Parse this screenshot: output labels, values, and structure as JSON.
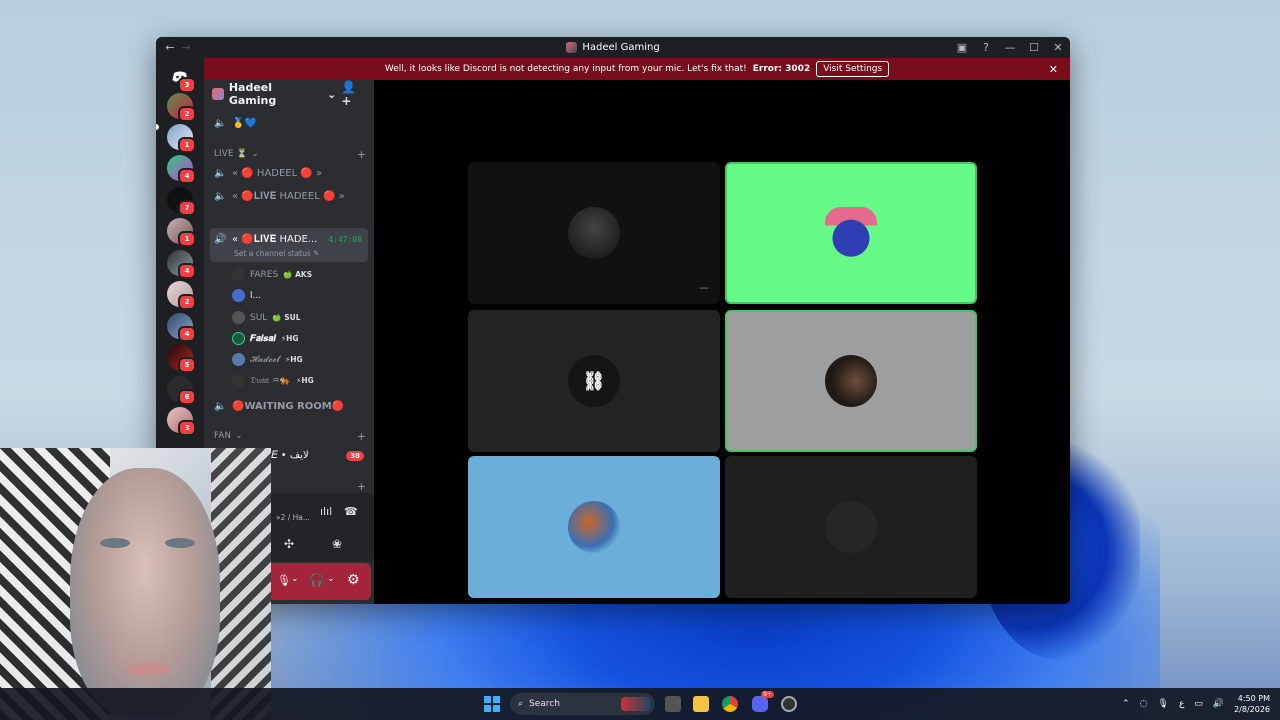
{
  "window": {
    "title": "Hadeel Gaming",
    "back_icon": "←",
    "forward_icon": "→"
  },
  "banner": {
    "message": "Well, it looks like Discord is not detecting any input from your mic. Let's fix that!",
    "error_label": "Error: 3002",
    "button_label": "Visit Settings",
    "close_icon": "✕"
  },
  "rail": {
    "badges": [
      "3",
      "2",
      "1",
      "4",
      "7",
      "1",
      "4",
      "2",
      "4",
      "5",
      "6",
      "3"
    ]
  },
  "server": {
    "name": "Hadeel Gaming",
    "chevron": "⌄",
    "first_channel_emoji": "🥇💙",
    "categories": [
      {
        "name": "LIVE ⏳"
      },
      {
        "name": "FAN"
      }
    ],
    "channels": [
      {
        "name": "« 🔴 HADEEL 🔴 »"
      },
      {
        "name": "« 🔴𝐋𝐈𝐕𝐄 HADEEL 🔴 »"
      },
      {
        "name": "« 🔴𝐋𝐈𝐕𝐄 HADE...",
        "timer": "4:47:08",
        "status": "Set a channel status ✎"
      },
      {
        "name": "🔴WAITING ROOM🔴"
      },
      {
        "name": "📶 ll 𝐿𝐼𝑉𝐸 • لايف",
        "badge": "38"
      }
    ],
    "members": [
      {
        "name": "FARES",
        "tag": "🍏 AKS",
        "color": "#333"
      },
      {
        "name": "l...",
        "tag": "",
        "color": "#4a6bd0"
      },
      {
        "name": "SUL",
        "tag": "🍏 SUL",
        "color": "#555"
      },
      {
        "name": "𝑭𝒂𝒊𝒔𝒂𝒍",
        "tag": "⚡HG",
        "color": "#1b5a3b"
      },
      {
        "name": "𝓗𝓪𝓭𝓮𝓮𝓵",
        "tag": "⚡HG",
        "color": "#5a7aa8"
      },
      {
        "name": "𝔇𝔲𝔞𝔞 ♒🐅",
        "tag": "⚡HG",
        "color": "#333"
      }
    ]
  },
  "voice_panel": {
    "channel_text": "»2 / Ha..."
  },
  "tiles": [
    {
      "bg": "#111111",
      "avatar": "#2a2a2a",
      "speaking": false,
      "menu": "⋯"
    },
    {
      "bg": "#66fa86",
      "avatar": "#2f3fb3",
      "speaking": true
    },
    {
      "bg": "#232323",
      "avatar": "#151515",
      "speaking": false
    },
    {
      "bg": "#9e9e9e",
      "avatar": "#1f1a16",
      "speaking": true
    },
    {
      "bg": "#6aaed9",
      "avatar": "#3a6fb1",
      "speaking": false
    },
    {
      "bg": "#1f1f1f",
      "avatar": "#262626",
      "speaking": false
    }
  ],
  "taskbar": {
    "search_placeholder": "Search",
    "time": "4:50 PM",
    "date": "2/8/2026",
    "discord_badge": "9+"
  }
}
